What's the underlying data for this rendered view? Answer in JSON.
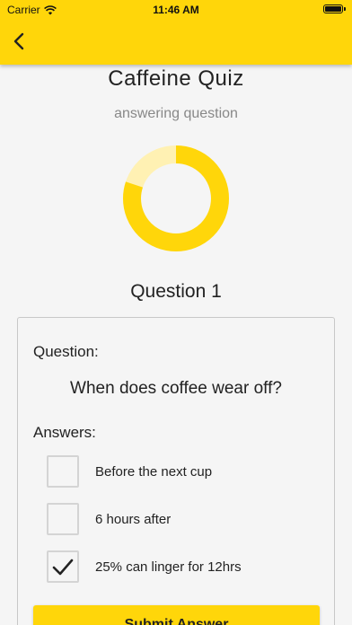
{
  "status_bar": {
    "carrier": "Carrier",
    "time": "11:46 AM",
    "battery_level": 1.0
  },
  "app_bar": {
    "back_icon": "chevron-left-icon",
    "color": "#ffd60a"
  },
  "quiz": {
    "title": "Caffeine Quiz",
    "status": "answering question",
    "progress": 0.8,
    "progress_color": "#ffd60a",
    "progress_track_color": "#fff1b3",
    "question_heading": "Question 1"
  },
  "card": {
    "question_label": "Question:",
    "question_text": "When does coffee wear off?",
    "answers_label": "Answers:",
    "answers": [
      {
        "text": "Before the next cup",
        "checked": false
      },
      {
        "text": "6 hours after",
        "checked": false
      },
      {
        "text": "25% can linger for 12hrs",
        "checked": true
      }
    ],
    "submit_label": "Submit Answer"
  }
}
